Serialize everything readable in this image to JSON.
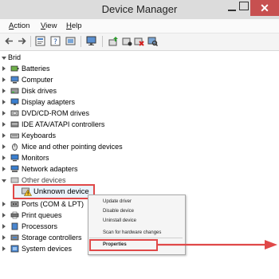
{
  "window": {
    "title": "Device Manager",
    "close_glyph": "✕"
  },
  "menu": [
    {
      "label": "Action",
      "mnemonic": "A",
      "rest": "ction"
    },
    {
      "label": "View",
      "mnemonic": "V",
      "rest": "iew"
    },
    {
      "label": "Help",
      "mnemonic": "H",
      "rest": "elp"
    }
  ],
  "toolbar": {
    "icons": [
      "back-arrow-icon",
      "forward-arrow-icon",
      "properties-icon",
      "help-icon",
      "driver-icon",
      "monitor-icon",
      "update-driver-icon",
      "disable-icon",
      "uninstall-icon",
      "scan-hardware-icon"
    ]
  },
  "tree": {
    "root": "Brid",
    "items": [
      {
        "label": "Batteries",
        "icon": "battery-icon"
      },
      {
        "label": "Computer",
        "icon": "computer-icon"
      },
      {
        "label": "Disk drives",
        "icon": "disk-drive-icon"
      },
      {
        "label": "Display adapters",
        "icon": "display-adapter-icon"
      },
      {
        "label": "DVD/CD-ROM drives",
        "icon": "dvd-drive-icon"
      },
      {
        "label": "IDE ATA/ATAPI controllers",
        "icon": "ide-controller-icon"
      },
      {
        "label": "Keyboards",
        "icon": "keyboard-icon"
      },
      {
        "label": "Mice and other pointing devices",
        "icon": "mouse-icon"
      },
      {
        "label": "Monitors",
        "icon": "monitor-icon"
      },
      {
        "label": "Network adapters",
        "icon": "network-adapter-icon"
      },
      {
        "label": "Other devices",
        "icon": "other-devices-icon"
      },
      {
        "label": "Unknown device",
        "icon": "unknown-device-warning-icon"
      },
      {
        "label": "Ports (COM & LPT)",
        "icon": "port-icon"
      },
      {
        "label": "Print queues",
        "icon": "printer-icon"
      },
      {
        "label": "Processors",
        "icon": "processor-icon"
      },
      {
        "label": "Storage controllers",
        "icon": "storage-controller-icon"
      },
      {
        "label": "System devices",
        "icon": "system-devices-icon"
      }
    ]
  },
  "context_menu": {
    "items": [
      "Update driver",
      "Disable device",
      "Uninstall device",
      "Scan for hardware changes",
      "Properties"
    ]
  },
  "colors": {
    "highlight": "#e04848",
    "close": "#c75050",
    "selection": "#eaf3fb"
  }
}
